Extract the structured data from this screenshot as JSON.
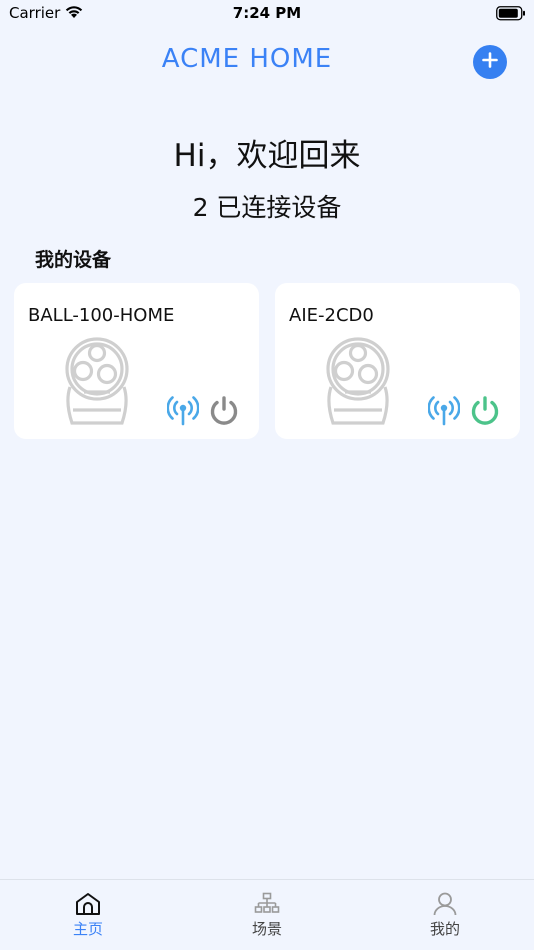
{
  "status_bar": {
    "carrier": "Carrier",
    "time": "7:24 PM"
  },
  "header": {
    "title": "ACME HOME"
  },
  "greeting": "Hi，欢迎回来",
  "connected": {
    "count": "2",
    "label": "已连接设备"
  },
  "section_title": "我的设备",
  "devices": [
    {
      "name": "BALL-100-HOME",
      "power_state": "off",
      "power_color": "#8a8a8a"
    },
    {
      "name": "AIE-2CD0",
      "power_state": "on",
      "power_color": "#4cc38a"
    }
  ],
  "colors": {
    "accent": "#3b82f6",
    "signal": "#4aa8e8",
    "background": "#f1f5fe"
  },
  "tabs": [
    {
      "label": "主页",
      "icon": "home-icon",
      "active": true
    },
    {
      "label": "场景",
      "icon": "scene-icon",
      "active": false
    },
    {
      "label": "我的",
      "icon": "profile-icon",
      "active": false
    }
  ]
}
